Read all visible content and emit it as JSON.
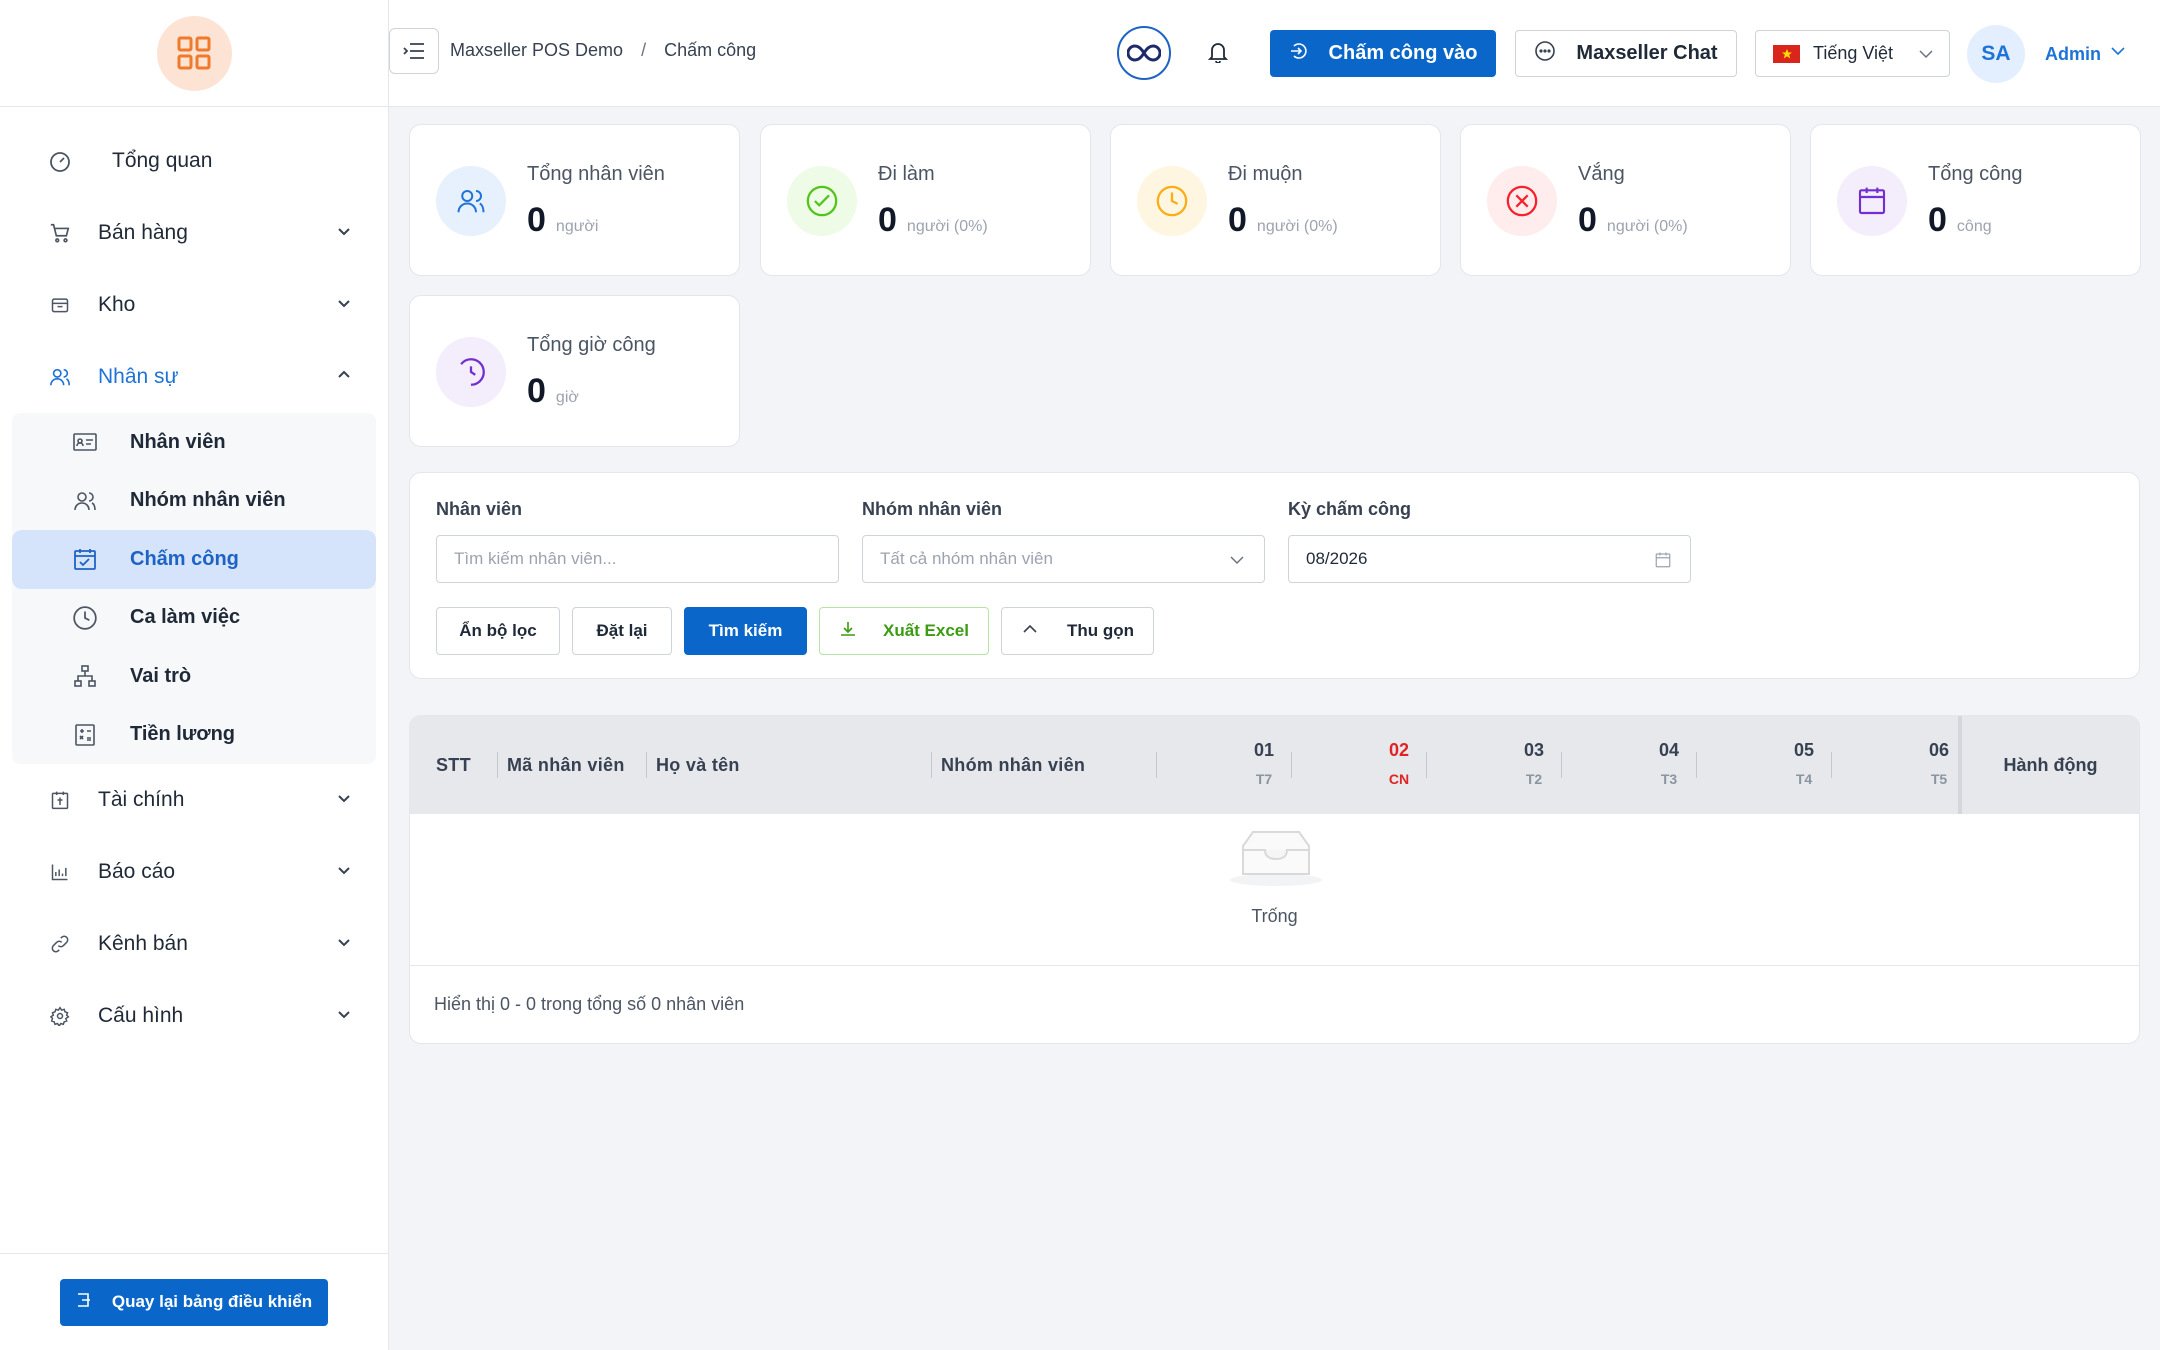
{
  "header": {
    "breadcrumb": [
      "Maxseller POS Demo",
      "/",
      "Chấm công"
    ],
    "checkin_label": "Chấm công vào",
    "chat_label": "Maxseller Chat",
    "language": "Tiếng Việt",
    "avatar_initials": "SA",
    "user_name": "Admin"
  },
  "sidebar": {
    "items": [
      {
        "label": "Tổng quan",
        "icon": "dashboard-icon"
      },
      {
        "label": "Bán hàng",
        "icon": "cart-icon"
      },
      {
        "label": "Kho",
        "icon": "box-icon"
      },
      {
        "label": "Nhân sự",
        "icon": "users-icon"
      },
      {
        "label": "Tài chính",
        "icon": "finance-icon"
      },
      {
        "label": "Báo cáo",
        "icon": "chart-icon"
      },
      {
        "label": "Kênh bán",
        "icon": "link-icon"
      },
      {
        "label": "Cấu hình",
        "icon": "gear-icon"
      }
    ],
    "subitems": [
      {
        "label": "Nhân viên",
        "icon": "id-card-icon"
      },
      {
        "label": "Nhóm nhân viên",
        "icon": "user-group-icon"
      },
      {
        "label": "Chấm công",
        "icon": "calendar-check-icon"
      },
      {
        "label": "Ca làm việc",
        "icon": "clock-icon"
      },
      {
        "label": "Vai trò",
        "icon": "hierarchy-icon"
      },
      {
        "label": "Tiền lương",
        "icon": "calculator-icon"
      }
    ],
    "back_label": "Quay lại bảng điều khiển"
  },
  "stats": [
    {
      "label": "Tổng nhân viên",
      "value": "0",
      "unit": "người",
      "color": "#1e73d8"
    },
    {
      "label": "Đi làm",
      "value": "0",
      "unit": "người (0%)",
      "color": "#52c41a"
    },
    {
      "label": "Đi muộn",
      "value": "0",
      "unit": "người (0%)",
      "color": "#faad14"
    },
    {
      "label": "Vắng",
      "value": "0",
      "unit": "người (0%)",
      "color": "#f5222d"
    },
    {
      "label": "Tổng công",
      "value": "0",
      "unit": "công",
      "color": "#722ed1"
    },
    {
      "label": "Tổng giờ công",
      "value": "0",
      "unit": "giờ",
      "color": "#722ed1"
    }
  ],
  "filter": {
    "employee_label": "Nhân viên",
    "employee_placeholder": "Tìm kiếm nhân viên...",
    "group_label": "Nhóm nhân viên",
    "group_placeholder": "Tất cả nhóm nhân viên",
    "period_label": "Kỳ chấm công",
    "period_value": "08/2026",
    "btn_hide": "Ẩn bộ lọc",
    "btn_reset": "Đặt lại",
    "btn_search": "Tìm kiếm",
    "btn_export": "Xuất Excel",
    "btn_collapse": "Thu gọn"
  },
  "table": {
    "col_stt": "STT",
    "col_code": "Mã nhân viên",
    "col_name": "Họ và tên",
    "col_group": "Nhóm nhân viên",
    "days": [
      {
        "num": "01",
        "day": "T7"
      },
      {
        "num": "02",
        "day": "CN"
      },
      {
        "num": "03",
        "day": "T2"
      },
      {
        "num": "04",
        "day": "T3"
      },
      {
        "num": "05",
        "day": "T4"
      },
      {
        "num": "06",
        "day": "T5"
      }
    ],
    "col_action": "Hành động",
    "empty_text": "Trống",
    "summary": "Hiển thị 0 - 0 trong tổng số 0 nhân viên"
  },
  "colors": {
    "primary": "#0a66c9",
    "active_bg": "#d5e4fb",
    "sunday": "#e02424"
  }
}
